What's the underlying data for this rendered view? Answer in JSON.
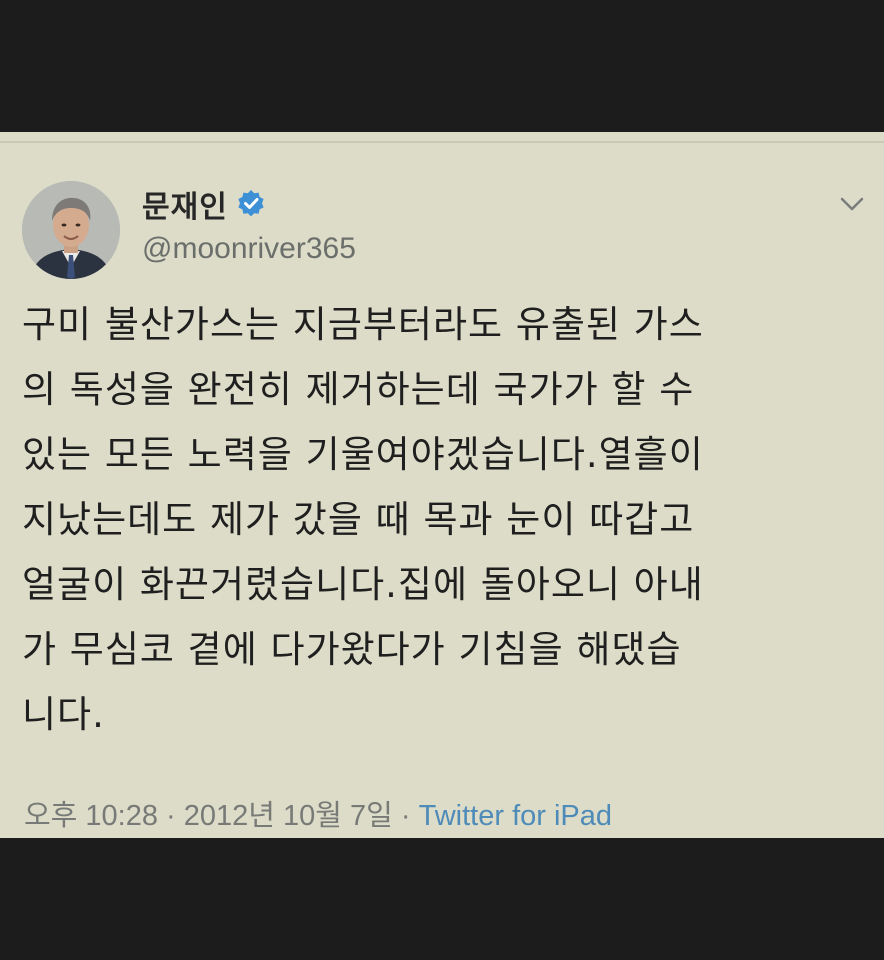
{
  "tweet": {
    "author": {
      "display_name": "문재인",
      "handle": "@moonriver365",
      "verified": true,
      "avatar_icon": "person-portrait"
    },
    "text_lines": [
      "구미 불산가스는 지금부터라도 유출된 가스",
      "의 독성을 완전히 제거하는데 국가가 할 수",
      "있는 모든 노력을 기울여야겠습니다.열흘이",
      "지났는데도 제가 갔을 때 목과 눈이 따갑고",
      "얼굴이 화끈거렸습니다.집에 돌아오니 아내",
      "가 무심코 곁에 다가왔다가 기침을 해댔습",
      "니다."
    ],
    "time": "오후 10:28",
    "separator_1": " · ",
    "date": "2012년 10월 7일",
    "separator_2": " · ",
    "source": "Twitter for iPad",
    "menu_icon": "chevron-down-icon"
  },
  "colors": {
    "card_background": "#dcdcc8",
    "frame_background": "#1c1c1c",
    "verified_badge": "#3d8fd6",
    "source_link": "#4f8bb8",
    "meta_text": "#777a77"
  }
}
